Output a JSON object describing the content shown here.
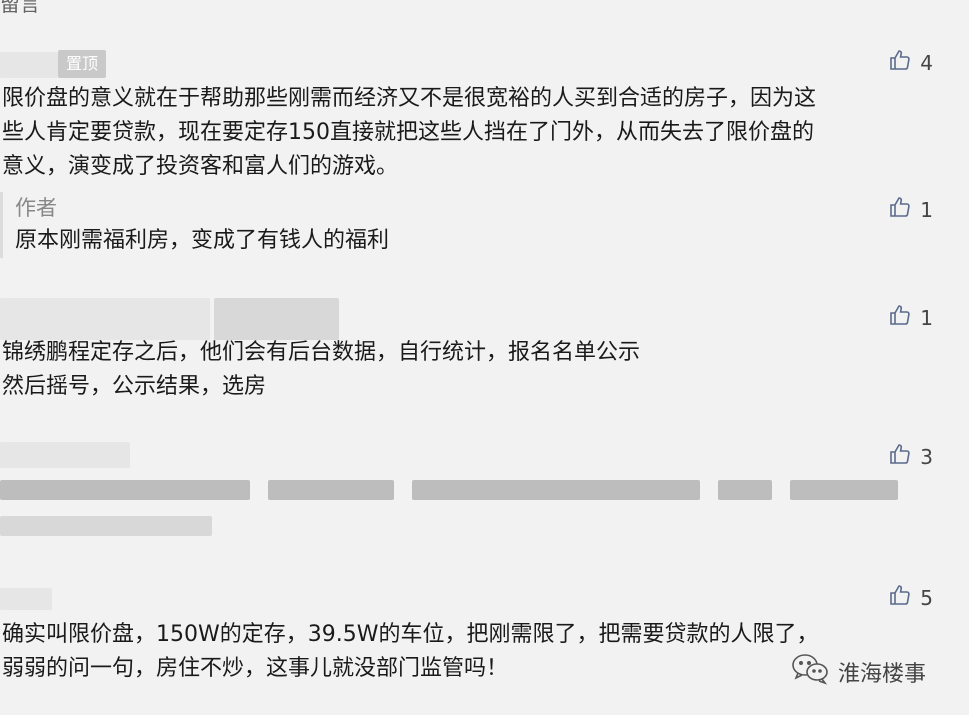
{
  "header": {
    "partial_label": "留言"
  },
  "comments": [
    {
      "badge": "置顶",
      "likes": "4",
      "text": "限价盘的意义就在于帮助那些刚需而经济又不是很宽裕的人买到合适的房子，因为这\n些人肯定要贷款，现在要定存150直接就把这些人挡在了门外，从而失去了限价盘的\n意义，演变成了投资客和富人们的游戏。",
      "reply": {
        "tag": "作者",
        "likes": "1",
        "text": "原本刚需福利房，变成了有钱人的福利"
      }
    },
    {
      "likes": "1",
      "text": "锦绣鹏程定存之后，他们会有后台数据，自行统计，报名名单公示\n然后摇号，公示结果，选房"
    },
    {
      "likes": "3"
    },
    {
      "likes": "5",
      "text": "确实叫限价盘，150W的定存，39.5W的车位，把刚需限了，把需要贷款的人限了，\n弱弱的问一句，房住不炒，这事儿就没部门监管吗！"
    }
  ],
  "watermark": {
    "text": "淮海楼事",
    "icon": "wechat-icon"
  },
  "icons": {
    "like": "thumbs-up-icon"
  }
}
